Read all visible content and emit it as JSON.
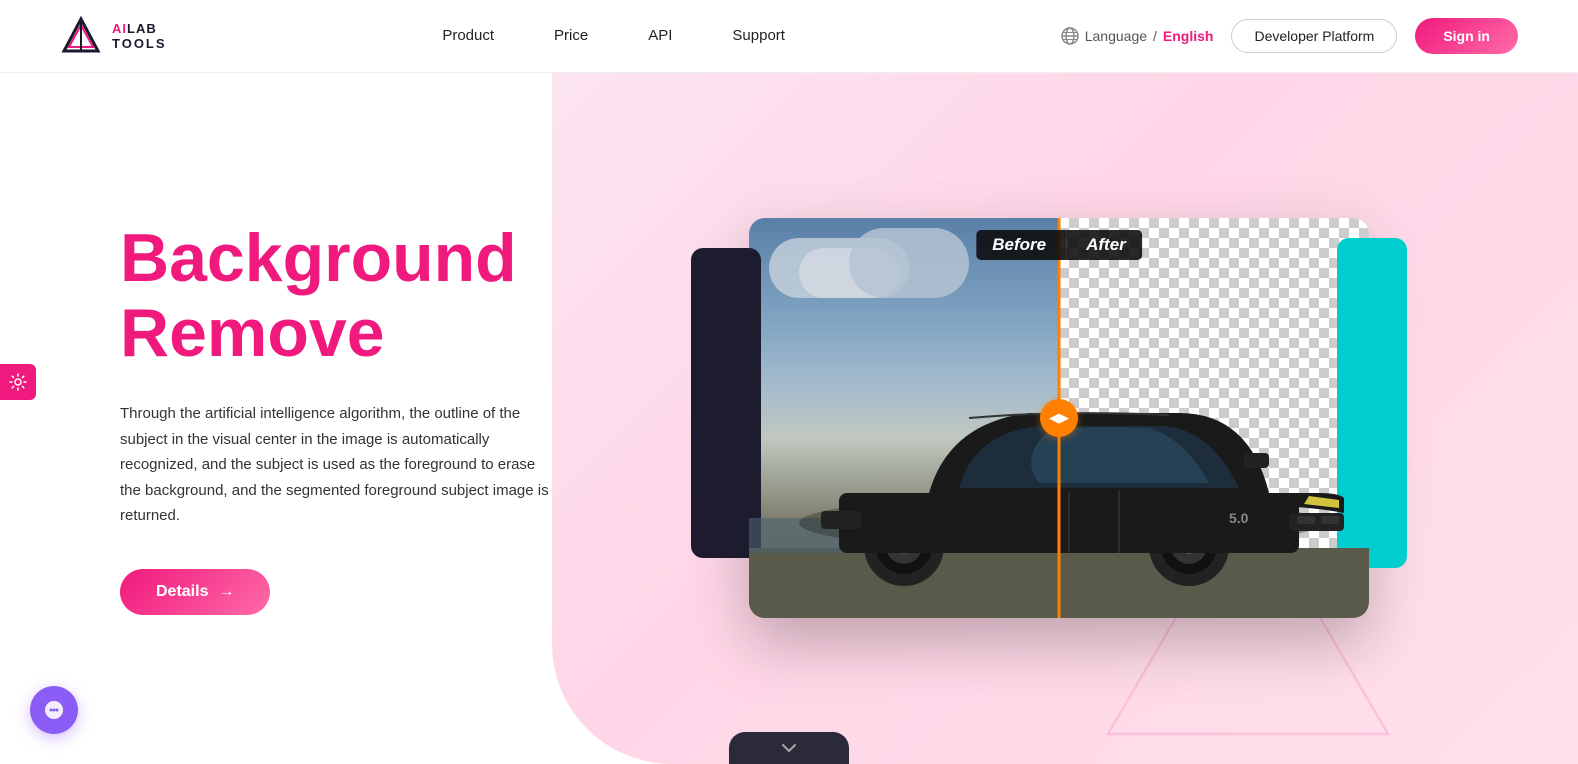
{
  "brand": {
    "name_part1": "AI",
    "name_part2": "LAB",
    "name_part3": "TOOLS",
    "logo_alt": "AiLabTools Logo"
  },
  "nav": {
    "links": [
      {
        "id": "product",
        "label": "Product"
      },
      {
        "id": "price",
        "label": "Price"
      },
      {
        "id": "api",
        "label": "API"
      },
      {
        "id": "support",
        "label": "Support"
      }
    ],
    "language_label": "Language",
    "language_value": "English",
    "dev_platform_label": "Developer Platform",
    "sign_in_label": "Sign in"
  },
  "hero": {
    "title_line1": "Background",
    "title_line2": "Remove",
    "description": "Through the artificial intelligence algorithm, the outline of the subject in the visual center in the image is automatically recognized, and the subject is used as the foreground to erase the background, and the segmented foreground subject image is returned.",
    "cta_label": "Details",
    "cta_arrow": "→"
  },
  "comparison": {
    "before_label": "Before",
    "after_label": "After"
  },
  "colors": {
    "pink_primary": "#f0197d",
    "pink_gradient_end": "#ff6ba8",
    "orange_divider": "#ff8000",
    "dark_card": "#1c1c2e",
    "cyan_card": "#00cdcd",
    "bg_pink_light": "#fce4f0"
  },
  "floating": {
    "settings_icon": "⚙",
    "chat_icon": "💬"
  }
}
